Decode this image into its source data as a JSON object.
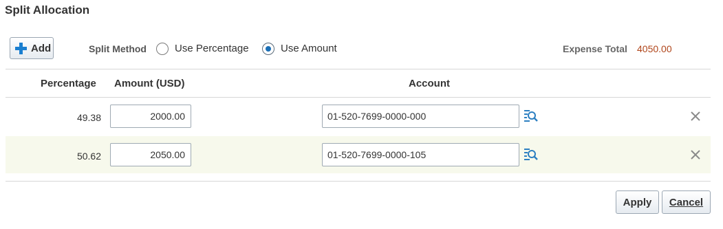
{
  "dialog": {
    "title": "Split Allocation"
  },
  "toolbar": {
    "add_label": "Add",
    "split_method_label": "Split Method",
    "options": [
      {
        "label": "Use Percentage",
        "selected": false
      },
      {
        "label": "Use Amount",
        "selected": true
      }
    ],
    "expense_total_label": "Expense Total",
    "expense_total_value": "4050.00"
  },
  "table": {
    "headers": {
      "percentage": "Percentage",
      "amount": "Amount (USD)",
      "account": "Account"
    },
    "rows": [
      {
        "percentage": "49.38",
        "amount": "2000.00",
        "account": "01-520-7699-0000-000"
      },
      {
        "percentage": "50.62",
        "amount": "2050.00",
        "account": "01-520-7699-0000-105"
      }
    ]
  },
  "footer": {
    "apply_label": "Apply",
    "cancel_label": "Cancel"
  },
  "colors": {
    "accent": "#1b6fb6",
    "total_value": "#b0461b",
    "alt_row": "#f7f9ec"
  },
  "icons": {
    "add": "plus-icon",
    "account_search": "search-icon",
    "delete_row": "close-icon"
  }
}
